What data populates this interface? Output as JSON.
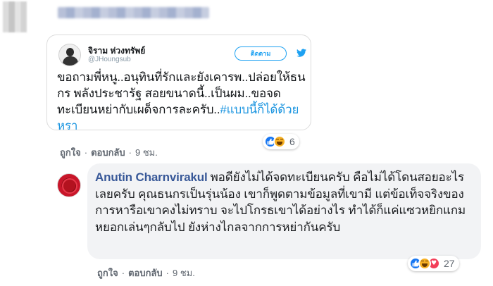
{
  "top_comment": {
    "tweet": {
      "author_name": "จิราม ห่วงทรัพย์",
      "author_handle": "@JHoungsub",
      "follow_label": "ติดตาม",
      "text": "ขอถามพี่หนู..อนุทินที่รักและยังเคารพ..ปล่อยให้ธนกร พลังประชารัฐ สอยขนาดนี้..เป็นผม..ขอจดทะเบียนหย่ากับเผด็จการละครับ..",
      "hashtag": "#แบบนี้ก็ได้ด้วยหรา"
    },
    "reactions": {
      "icons": [
        "like-icon",
        "haha-icon"
      ],
      "count": "6"
    },
    "actions": {
      "like": "ถูกใจ",
      "reply": "ตอบกลับ",
      "time": "9 ชม."
    }
  },
  "reply": {
    "author": "Anutin Charnvirakul",
    "text": "พอดียังไม่ได้จดทะเบียนครับ คือไม่ได้โดนสอยอะไรเลยครับ คุณธนกรเป็นรุ่นน้อง เขาก็พูดตามข้อมูลที่เขามี แต่ข้อเท็จจริงของการหารือเขาคงไม่ทราบ จะไปโกรธเขาได้อย่างไร ทำได้ก็แค่แซวหยิกแกมหยอกเล่นๆกลับไป ยังห่างไกลจากการหย่ากันครับ",
    "reactions": {
      "icons": [
        "like-icon",
        "haha-icon",
        "love-icon"
      ],
      "count": "27"
    },
    "actions": {
      "like": "ถูกใจ",
      "reply": "ตอบกลับ",
      "time": "9 ชม."
    }
  },
  "colors": {
    "facebook_link": "#385898",
    "twitter_blue": "#1da1f2",
    "hashtag": "#1b95e0",
    "like_blue": "#1877f2",
    "haha_yellow": "#f7b125",
    "love_red": "#f33e58",
    "bubble_grey": "#f2f3f5",
    "meta_grey": "#606770"
  }
}
